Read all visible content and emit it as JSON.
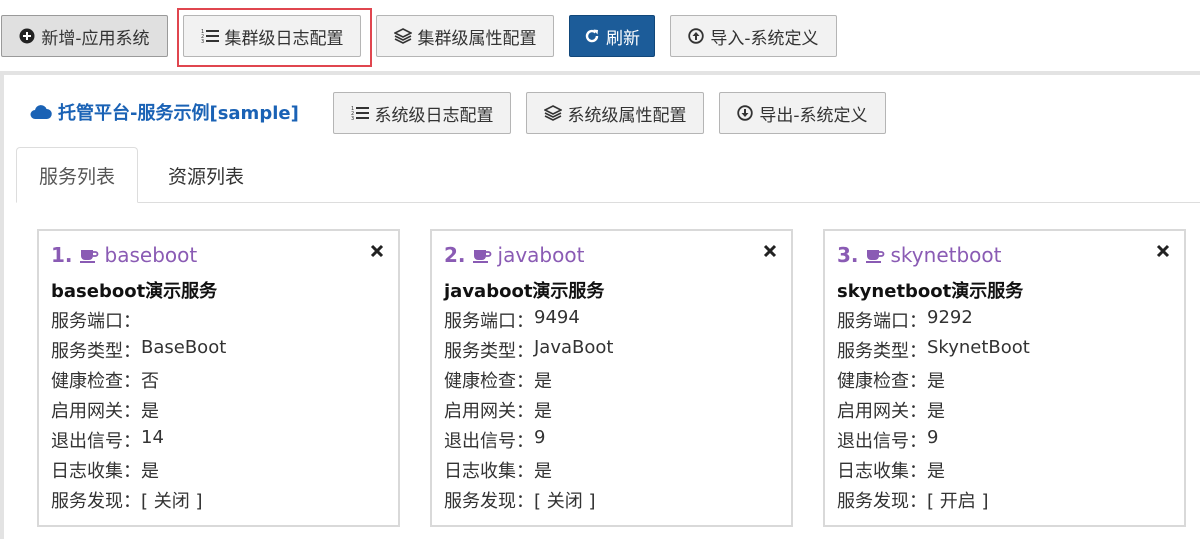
{
  "toolbar": {
    "add_app": {
      "label": "新增-应用系统",
      "icon": "plus-circle-icon"
    },
    "cluster_log": {
      "label": "集群级日志配置",
      "icon": "list-ol-icon"
    },
    "cluster_attr": {
      "label": "集群级属性配置",
      "icon": "layers-icon"
    },
    "refresh": {
      "label": "刷新",
      "icon": "refresh-icon"
    },
    "import": {
      "label": "导入-系统定义",
      "icon": "arrow-up-circle-icon"
    }
  },
  "platform": {
    "title": "托管平台-服务示例[sample]",
    "icon": "cloud-icon",
    "buttons": {
      "system_log": {
        "label": "系统级日志配置",
        "icon": "list-ol-icon"
      },
      "system_attr": {
        "label": "系统级属性配置",
        "icon": "layers-icon"
      },
      "export": {
        "label": "导出-系统定义",
        "icon": "arrow-down-circle-icon"
      }
    }
  },
  "tabs": [
    {
      "label": "服务列表",
      "active": true
    },
    {
      "label": "资源列表",
      "active": false
    }
  ],
  "services": [
    {
      "num": "1.",
      "name": "baseboot",
      "title": "baseboot演示服务",
      "fields": [
        {
          "label": "服务端口：",
          "value": ""
        },
        {
          "label": "服务类型：",
          "value": "BaseBoot"
        },
        {
          "label": "健康检查：",
          "value": "否"
        },
        {
          "label": "启用网关：",
          "value": "是"
        },
        {
          "label": "退出信号：",
          "value": "14"
        },
        {
          "label": "日志收集：",
          "value": "是"
        },
        {
          "label": "服务发现：",
          "value": "[ 关闭 ]"
        }
      ]
    },
    {
      "num": "2.",
      "name": "javaboot",
      "title": "javaboot演示服务",
      "fields": [
        {
          "label": "服务端口：",
          "value": "9494"
        },
        {
          "label": "服务类型：",
          "value": "JavaBoot"
        },
        {
          "label": "健康检查：",
          "value": "是"
        },
        {
          "label": "启用网关：",
          "value": "是"
        },
        {
          "label": "退出信号：",
          "value": "9"
        },
        {
          "label": "日志收集：",
          "value": "是"
        },
        {
          "label": "服务发现：",
          "value": "[ 关闭 ]"
        }
      ]
    },
    {
      "num": "3.",
      "name": "skynetboot",
      "title": "skynetboot演示服务",
      "fields": [
        {
          "label": "服务端口：",
          "value": "9292"
        },
        {
          "label": "服务类型：",
          "value": "SkynetBoot"
        },
        {
          "label": "健康检查：",
          "value": "是"
        },
        {
          "label": "启用网关：",
          "value": "是"
        },
        {
          "label": "退出信号：",
          "value": "9"
        },
        {
          "label": "日志收集：",
          "value": "是"
        },
        {
          "label": "服务发现：",
          "value": "[ 开启 ]"
        }
      ]
    }
  ],
  "colors": {
    "primary": "#1c5c99",
    "title_blue": "#1a62b5",
    "service_purple": "#8a5bb4",
    "highlight_red": "#e0464f"
  }
}
